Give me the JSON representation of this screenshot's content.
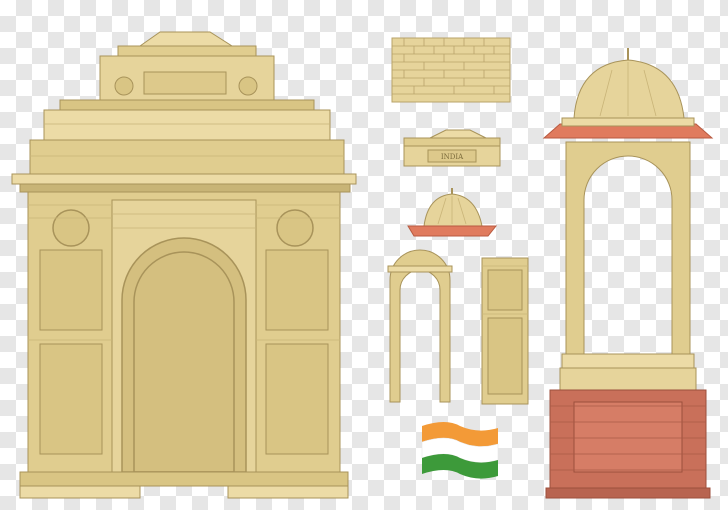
{
  "plaque_text": "INDIA",
  "colors": {
    "stone": "#e0cd8f",
    "stone_light": "#ecdba6",
    "stone_dark": "#b8a36a",
    "stone_line": "#a8935a",
    "canopy_red": "#e07b5e",
    "brick": "#c9705a",
    "saffron": "#f39a37",
    "flag_green": "#3d9a3a",
    "background_checker": "#e6e6e6"
  }
}
